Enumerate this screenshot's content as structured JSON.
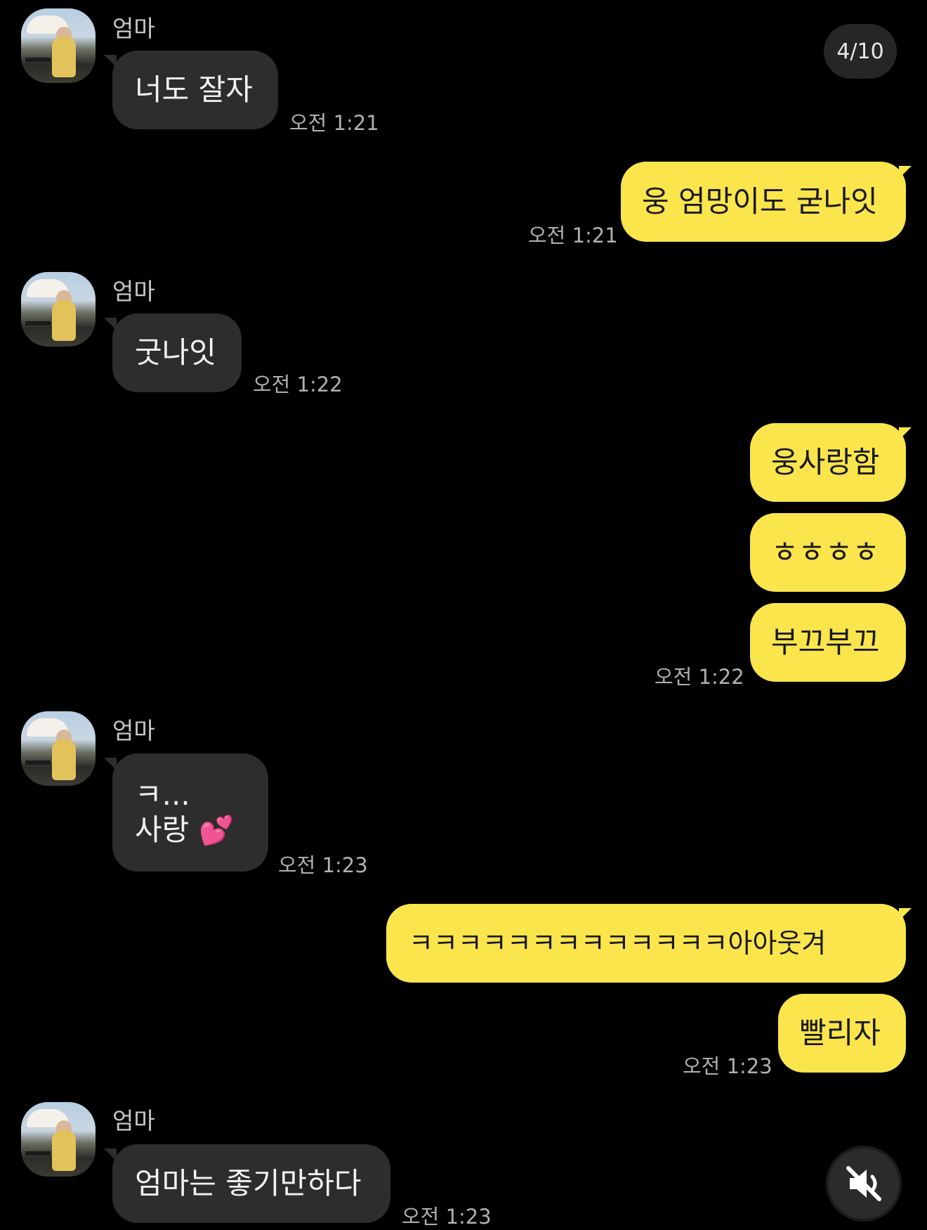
{
  "counter": "4/10",
  "contact_name": "엄마",
  "messages": [
    {
      "text": "너도 잘자",
      "time": "오전 1:21"
    },
    {
      "text": "웅 엄망이도 굳나잇",
      "time": "오전 1:21"
    },
    {
      "text": "굿나잇",
      "time": "오전 1:22"
    },
    {
      "text": "웅사랑함"
    },
    {
      "text": "ㅎㅎㅎㅎ"
    },
    {
      "text": "부끄부끄",
      "time": "오전 1:22"
    },
    {
      "line1": "ㅋ...",
      "line2": "사랑",
      "emoji": "💕",
      "time": "오전 1:23"
    },
    {
      "text": "ㅋㅋㅋㅋㅋㅋㅋㅋㅋㅋㅋㅋㅋ아아웃겨"
    },
    {
      "text": "빨리자",
      "time": "오전 1:23"
    },
    {
      "text": "엄마는 좋기만하다",
      "time": "오전 1:23"
    }
  ],
  "mute_icon": "speaker-muted-icon"
}
